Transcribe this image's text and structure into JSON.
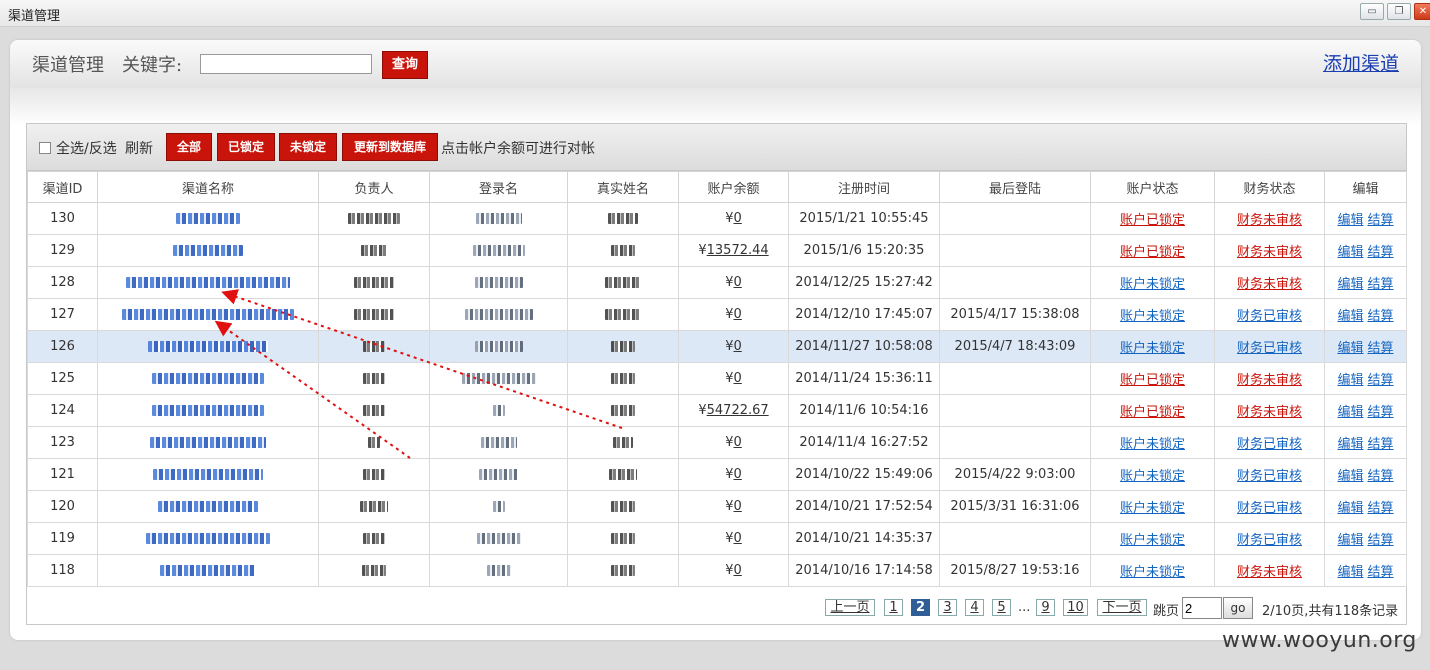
{
  "window": {
    "title": "渠道管理",
    "min_glyph": "▭",
    "max_glyph": "❐",
    "close_glyph": "✕"
  },
  "search": {
    "title": "渠道管理",
    "keyword_label": "关键字:",
    "keyword_value": "",
    "query_label": "查询",
    "add_channel_label": "添加渠道"
  },
  "toolbar": {
    "select_all_label": "全选/反选",
    "refresh_label": "刷新",
    "btn_all": "全部",
    "btn_locked": "已锁定",
    "btn_unlocked": "未锁定",
    "btn_update_db": "更新到数据库",
    "tip": "点击帐户余额可进行对帐"
  },
  "table": {
    "headers": [
      "渠道ID",
      "渠道名称",
      "负责人",
      "登录名",
      "真实姓名",
      "账户余额",
      "注册时间",
      "最后登陆",
      "账户状态",
      "财务状态",
      "编辑"
    ],
    "edit_label": "编辑",
    "settle_label": "结算",
    "currency": "¥",
    "rows": [
      {
        "id": "130",
        "balance": "0",
        "reg": "2015/1/21 10:55:45",
        "last": "",
        "acct": "账户已锁定",
        "acct_color": "red",
        "fin": "财务未审核",
        "fin_color": "red",
        "hl": false
      },
      {
        "id": "129",
        "balance": "13572.44",
        "reg": "2015/1/6 15:20:35",
        "last": "",
        "acct": "账户已锁定",
        "acct_color": "red",
        "fin": "财务未审核",
        "fin_color": "red",
        "hl": false
      },
      {
        "id": "128",
        "balance": "0",
        "reg": "2014/12/25 15:27:42",
        "last": "",
        "acct": "账户未锁定",
        "acct_color": "blue",
        "fin": "财务未审核",
        "fin_color": "red",
        "hl": false
      },
      {
        "id": "127",
        "balance": "0",
        "reg": "2014/12/10 17:45:07",
        "last": "2015/4/17 15:38:08",
        "acct": "账户未锁定",
        "acct_color": "blue",
        "fin": "财务已审核",
        "fin_color": "blue",
        "hl": false
      },
      {
        "id": "126",
        "balance": "0",
        "reg": "2014/11/27 10:58:08",
        "last": "2015/4/7 18:43:09",
        "acct": "账户未锁定",
        "acct_color": "blue",
        "fin": "财务已审核",
        "fin_color": "blue",
        "hl": true
      },
      {
        "id": "125",
        "balance": "0",
        "reg": "2014/11/24 15:36:11",
        "last": "",
        "acct": "账户已锁定",
        "acct_color": "red",
        "fin": "财务未审核",
        "fin_color": "red",
        "hl": false
      },
      {
        "id": "124",
        "balance": "54722.67",
        "reg": "2014/11/6 10:54:16",
        "last": "",
        "acct": "账户已锁定",
        "acct_color": "red",
        "fin": "财务未审核",
        "fin_color": "red",
        "hl": false
      },
      {
        "id": "123",
        "balance": "0",
        "reg": "2014/11/4 16:27:52",
        "last": "",
        "acct": "账户未锁定",
        "acct_color": "blue",
        "fin": "财务已审核",
        "fin_color": "blue",
        "hl": false
      },
      {
        "id": "121",
        "balance": "0",
        "reg": "2014/10/22 15:49:06",
        "last": "2015/4/22 9:03:00",
        "acct": "账户未锁定",
        "acct_color": "blue",
        "fin": "财务已审核",
        "fin_color": "blue",
        "hl": false
      },
      {
        "id": "120",
        "balance": "0",
        "reg": "2014/10/21 17:52:54",
        "last": "2015/3/31 16:31:06",
        "acct": "账户未锁定",
        "acct_color": "blue",
        "fin": "财务已审核",
        "fin_color": "blue",
        "hl": false
      },
      {
        "id": "119",
        "balance": "0",
        "reg": "2014/10/21 14:35:37",
        "last": "",
        "acct": "账户未锁定",
        "acct_color": "blue",
        "fin": "财务已审核",
        "fin_color": "blue",
        "hl": false
      },
      {
        "id": "118",
        "balance": "0",
        "reg": "2014/10/16 17:14:58",
        "last": "2015/8/27 19:53:16",
        "acct": "账户未锁定",
        "acct_color": "blue",
        "fin": "财务未审核",
        "fin_color": "red",
        "hl": false
      }
    ]
  },
  "pager": {
    "prev_label": "上一页",
    "pages": [
      "1",
      "2",
      "3",
      "4",
      "5"
    ],
    "ellipsis": "...",
    "more_pages": [
      "9",
      "10"
    ],
    "current": "2",
    "next_label": "下一页",
    "jump_label": "跳页",
    "jump_value": "2",
    "go_label": "go",
    "summary": "2/10页,共有118条记录"
  },
  "colors": {
    "accent_red": "#c8140a",
    "link_blue": "#1565c0",
    "highlight_row": "#dde8f6",
    "annotation_red": "#e01010"
  },
  "watermark": "www.wooyun.org"
}
